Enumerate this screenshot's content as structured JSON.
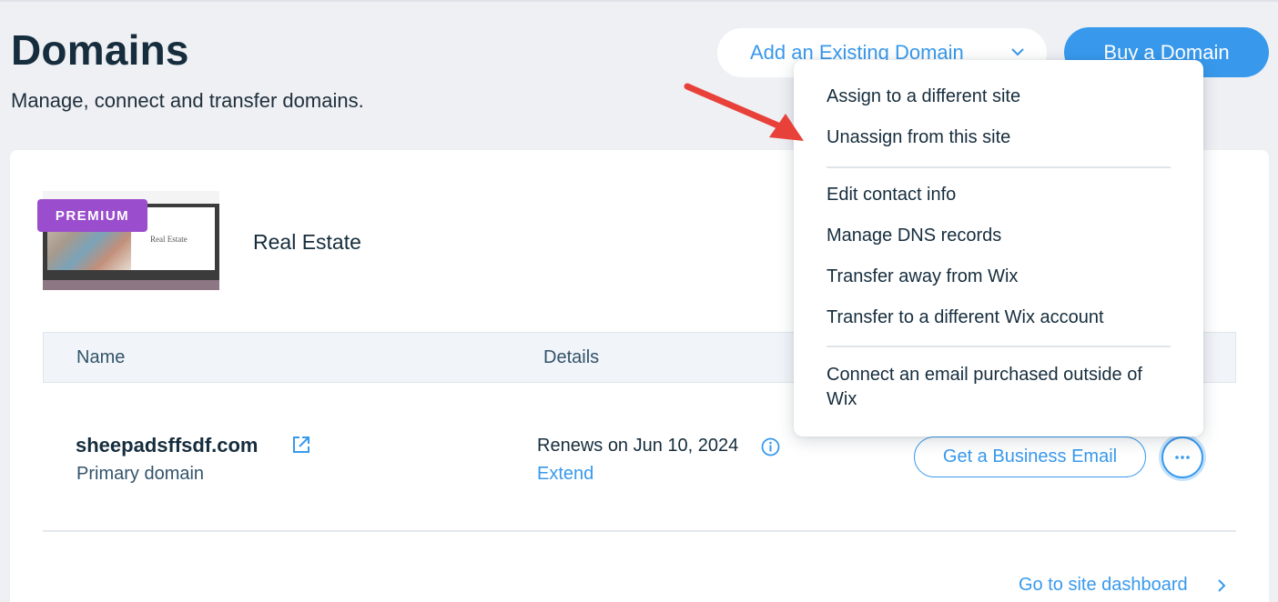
{
  "header": {
    "title": "Domains",
    "subtitle": "Manage, connect and transfer domains.",
    "add_existing_label": "Add an Existing Domain",
    "buy_label": "Buy a Domain"
  },
  "site": {
    "badge": "PREMIUM",
    "name": "Real Estate",
    "thumbnail_title": "Real Estate"
  },
  "table": {
    "columns": [
      "Name",
      "Details"
    ],
    "rows": [
      {
        "domain": "sheepadsffsdf.com",
        "type": "Primary domain",
        "renewal": "Renews on Jun 10, 2024",
        "extend_label": "Extend",
        "business_email_label": "Get a Business Email",
        "more_label": "···"
      }
    ]
  },
  "footer": {
    "dashboard_link": "Go to site dashboard"
  },
  "menu": {
    "items": [
      "Assign to a different site",
      "Unassign from this site",
      "Edit contact info",
      "Manage DNS records",
      "Transfer away from Wix",
      "Transfer to a different Wix account",
      "Connect an email purchased outside of Wix"
    ]
  },
  "colors": {
    "accent": "#3899ec",
    "premium": "#9a4dcc",
    "arrow": "#e8413a"
  }
}
